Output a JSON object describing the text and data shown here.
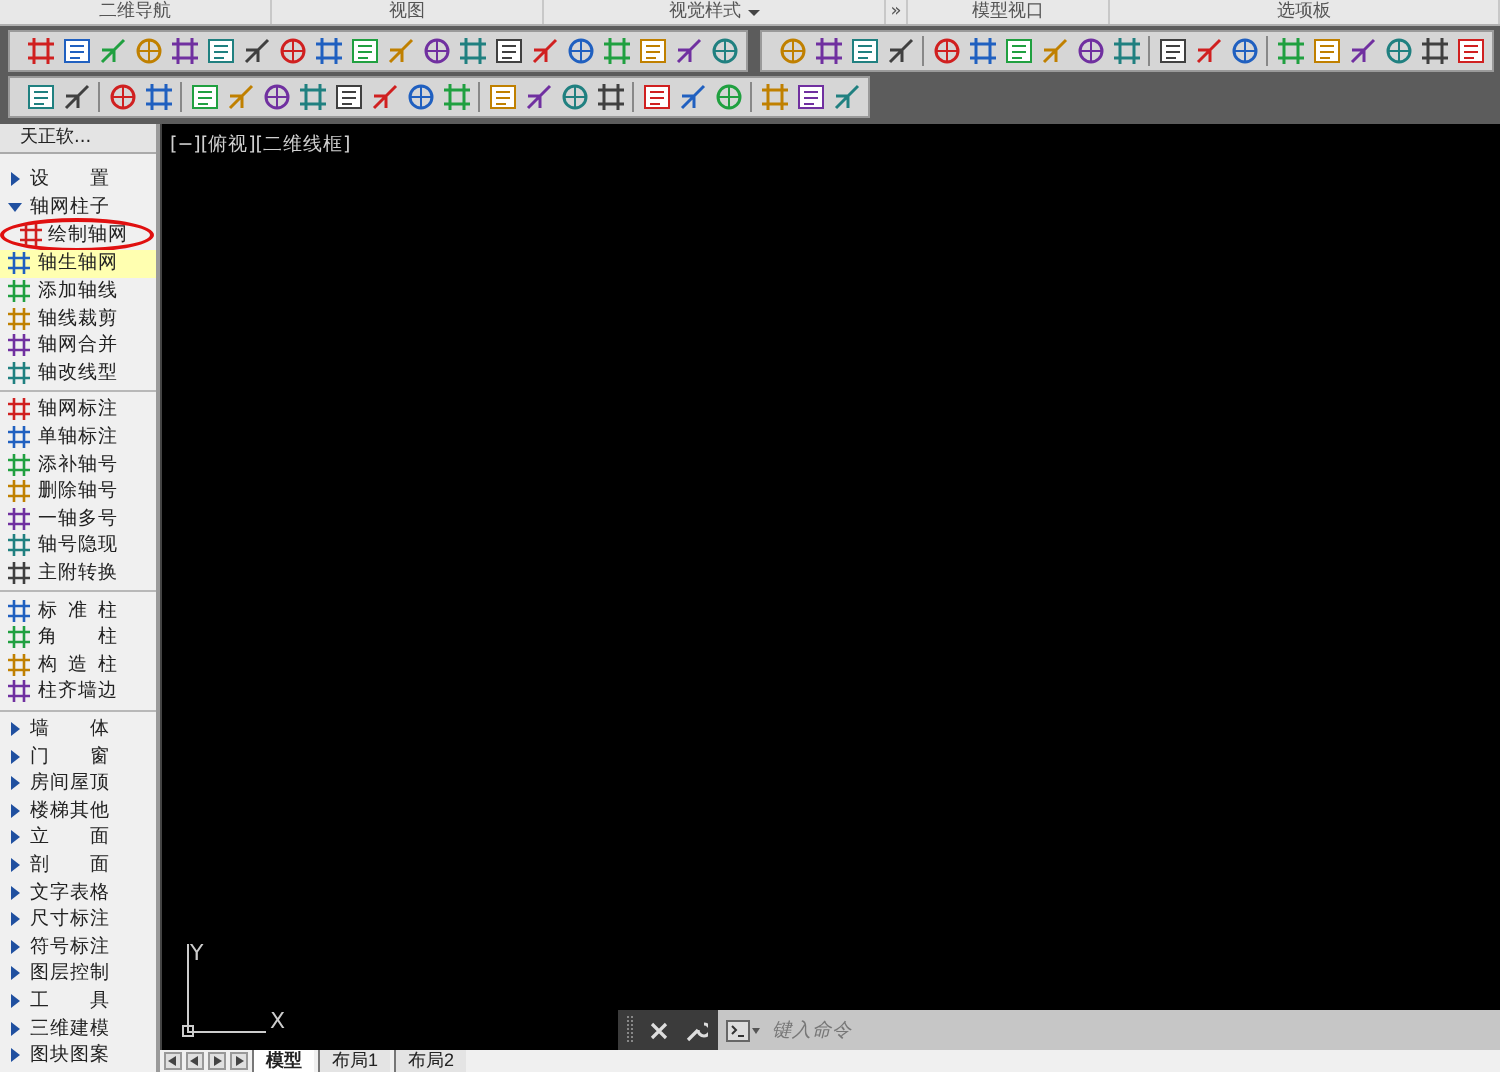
{
  "ribbon_panels": [
    {
      "title": "二维导航",
      "menu": false
    },
    {
      "title": "视图",
      "menu": false
    },
    {
      "title": "视觉样式",
      "menu": true
    },
    {
      "title": "»",
      "menu": false
    },
    {
      "title": "模型视口",
      "menu": false
    },
    {
      "title": "选项板",
      "menu": false
    }
  ],
  "sidebar": {
    "title": "天正软...",
    "items": [
      {
        "kind": "folder",
        "label": "设 置",
        "expanded": false
      },
      {
        "kind": "folder",
        "label": "轴网柱子",
        "expanded": true,
        "children": [
          {
            "kind": "command",
            "label": "绘制轴网",
            "selected": false,
            "circled": true
          },
          {
            "kind": "command",
            "label": "轴生轴网",
            "selected": true,
            "circled": false
          },
          {
            "kind": "command",
            "label": "添加轴线",
            "selected": false,
            "circled": false
          },
          {
            "kind": "command",
            "label": "轴线裁剪",
            "selected": false,
            "circled": false
          },
          {
            "kind": "command",
            "label": "轴网合并",
            "selected": false,
            "circled": false
          },
          {
            "kind": "command",
            "label": "轴改线型",
            "selected": false,
            "circled": false
          },
          {
            "kind": "separator"
          },
          {
            "kind": "command",
            "label": "轴网标注",
            "selected": false,
            "circled": false
          },
          {
            "kind": "command",
            "label": "单轴标注",
            "selected": false,
            "circled": false
          },
          {
            "kind": "command",
            "label": "添补轴号",
            "selected": false,
            "circled": false
          },
          {
            "kind": "command",
            "label": "删除轴号",
            "selected": false,
            "circled": false
          },
          {
            "kind": "command",
            "label": "一轴多号",
            "selected": false,
            "circled": false
          },
          {
            "kind": "command",
            "label": "轴号隐现",
            "selected": false,
            "circled": false
          },
          {
            "kind": "command",
            "label": "主附转换",
            "selected": false,
            "circled": false
          },
          {
            "kind": "separator"
          },
          {
            "kind": "command",
            "label": "标 准 柱",
            "selected": false,
            "circled": false
          },
          {
            "kind": "command",
            "label": "角 柱",
            "selected": false,
            "circled": false
          },
          {
            "kind": "command",
            "label": "构 造 柱",
            "selected": false,
            "circled": false
          },
          {
            "kind": "command",
            "label": "柱齐墙边",
            "selected": false,
            "circled": false
          },
          {
            "kind": "separator"
          }
        ]
      },
      {
        "kind": "folder",
        "label": "墙 体",
        "expanded": false
      },
      {
        "kind": "folder",
        "label": "门 窗",
        "expanded": false
      },
      {
        "kind": "folder",
        "label": "房间屋顶",
        "expanded": false
      },
      {
        "kind": "folder",
        "label": "楼梯其他",
        "expanded": false
      },
      {
        "kind": "folder",
        "label": "立 面",
        "expanded": false
      },
      {
        "kind": "folder",
        "label": "剖 面",
        "expanded": false
      },
      {
        "kind": "folder",
        "label": "文字表格",
        "expanded": false
      },
      {
        "kind": "folder",
        "label": "尺寸标注",
        "expanded": false
      },
      {
        "kind": "folder",
        "label": "符号标注",
        "expanded": false
      },
      {
        "kind": "folder",
        "label": "图层控制",
        "expanded": false
      },
      {
        "kind": "folder",
        "label": "工 具",
        "expanded": false
      },
      {
        "kind": "folder",
        "label": "三维建模",
        "expanded": false
      },
      {
        "kind": "folder",
        "label": "图块图案",
        "expanded": false
      }
    ]
  },
  "viewport": {
    "label": "[−][俯视][二维线框]",
    "axis_y": "Y",
    "axis_x": "X"
  },
  "command_line": {
    "placeholder": "键入命令"
  },
  "layout_tabs": [
    {
      "label": "模型",
      "selected": true
    },
    {
      "label": "布局1",
      "selected": false
    },
    {
      "label": "布局2",
      "selected": false
    }
  ]
}
